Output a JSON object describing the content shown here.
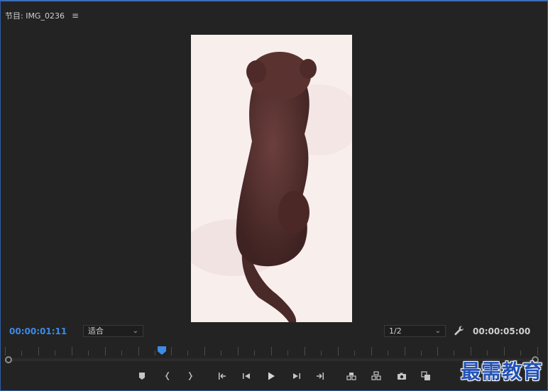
{
  "panel": {
    "title": "节目: IMG_0236",
    "menu_icon": "hamburger-menu-icon"
  },
  "preview": {
    "subject": "brown dog sitting, viewed from behind"
  },
  "controls": {
    "current_timecode": "00:00:01:11",
    "zoom_value": "适合",
    "resolution_value": "1/2",
    "duration_timecode": "00:00:05:00",
    "settings_icon": "wrench-icon"
  },
  "timeline": {
    "playhead_fraction": 0.29
  },
  "transport": {
    "buttons": [
      {
        "name": "add-marker-button",
        "icon": "marker-icon"
      },
      {
        "name": "mark-in-button",
        "icon": "mark-in-icon"
      },
      {
        "name": "mark-out-button",
        "icon": "mark-out-icon"
      },
      {
        "name": "go-to-in-button",
        "icon": "go-to-in-icon"
      },
      {
        "name": "step-back-button",
        "icon": "step-back-icon"
      },
      {
        "name": "play-button",
        "icon": "play-icon"
      },
      {
        "name": "step-forward-button",
        "icon": "step-forward-icon"
      },
      {
        "name": "go-to-out-button",
        "icon": "go-to-out-icon"
      },
      {
        "name": "lift-button",
        "icon": "lift-icon"
      },
      {
        "name": "extract-button",
        "icon": "extract-icon"
      },
      {
        "name": "export-frame-button",
        "icon": "camera-icon"
      },
      {
        "name": "comparison-view-button",
        "icon": "comparison-icon"
      }
    ]
  },
  "watermark": {
    "text": "最需教育"
  },
  "colors": {
    "accent_blue": "#3d8be5",
    "panel_bg": "#232323",
    "border_blue": "#2f5fa8"
  }
}
